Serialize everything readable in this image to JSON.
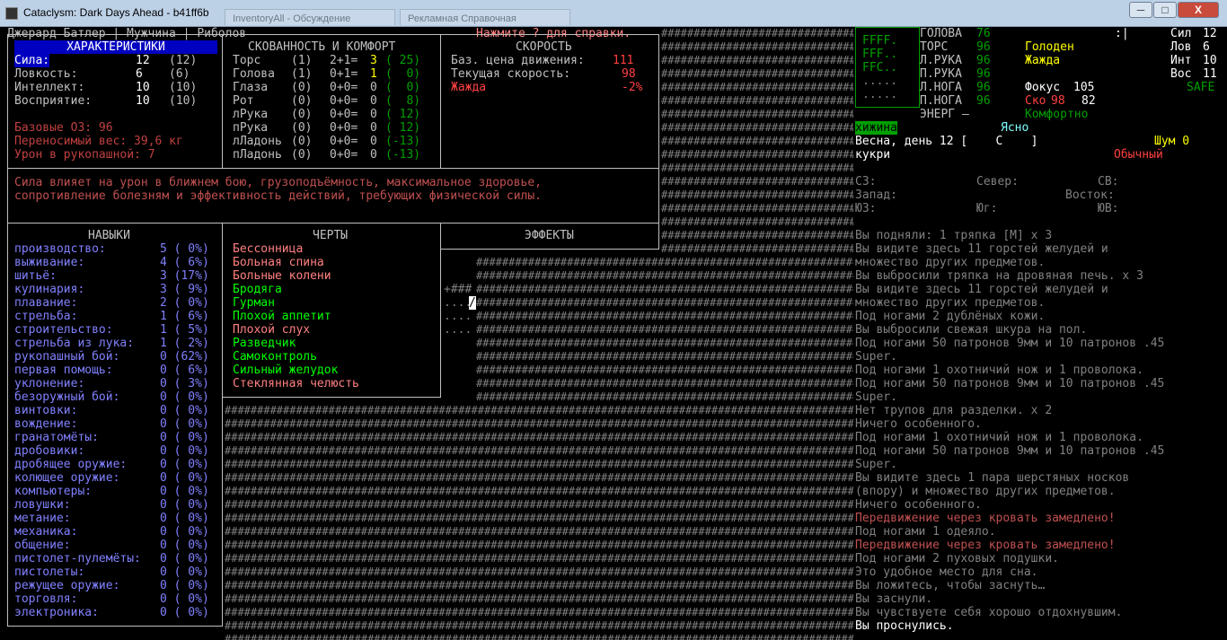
{
  "window": {
    "title": "Cataclysm: Dark Days Ahead - b41ff6b",
    "ghost_tabs": [
      "InventoryAll - Обсуждение",
      "Рекламная Справочная"
    ],
    "buttons": {
      "min": "─",
      "max": "□",
      "close": "X"
    }
  },
  "header": {
    "char_line": "Джерард Батлер | Мужчина | Риболов",
    "help": "Нажмите ? для справки."
  },
  "stats": {
    "title": "ХАРАКТЕРИСТИКИ",
    "rows": [
      {
        "label": "Сила:",
        "val": "12",
        "base": "(12)"
      },
      {
        "label": "Ловкость:",
        "val": "6",
        "base": "(6)"
      },
      {
        "label": "Интеллект:",
        "val": "10",
        "base": "(10)"
      },
      {
        "label": "Восприятие:",
        "val": "10",
        "base": "(10)"
      }
    ],
    "extra": [
      "Базовые ОЗ: 96",
      "Переносимый вес: 39,6 кг",
      "Урон в рукопашной: 7"
    ]
  },
  "encumbrance": {
    "title": "СКОВАННОСТЬ И КОМФОРТ",
    "rows": [
      {
        "part": "Торс",
        "a": "(1)",
        "b": "2+1=",
        "c": "3",
        "d": "( 25)"
      },
      {
        "part": "Голова",
        "a": "(1)",
        "b": "0+1=",
        "c": "1",
        "d": "(  0)"
      },
      {
        "part": "Глаза",
        "a": "(0)",
        "b": "0+0=",
        "c": "0",
        "d": "(  0)"
      },
      {
        "part": "Рот",
        "a": "(0)",
        "b": "0+0=",
        "c": "0",
        "d": "(  8)"
      },
      {
        "part": "лРука",
        "a": "(0)",
        "b": "0+0=",
        "c": "0",
        "d": "( 12)"
      },
      {
        "part": "пРука",
        "a": "(0)",
        "b": "0+0=",
        "c": "0",
        "d": "( 12)"
      },
      {
        "part": "лЛадонь",
        "a": "(0)",
        "b": "0+0=",
        "c": "0",
        "d": "(-13)"
      },
      {
        "part": "пЛадонь",
        "a": "(0)",
        "b": "0+0=",
        "c": "0",
        "d": "(-13)"
      }
    ]
  },
  "speed": {
    "title": "СКОРОСТЬ",
    "rows": [
      {
        "label": "Баз. цена движения:",
        "val": "111"
      },
      {
        "label": "Текущая скорость:",
        "val": "98"
      },
      {
        "label": "Жажда",
        "val": "-2%"
      }
    ]
  },
  "description": "Сила влияет на урон в ближнем бою, грузоподъёмность, максимальное здоровье,\nсопротивление болезням и эффективность действий, требующих физической силы.",
  "skills": {
    "title": "НАВЫКИ",
    "rows": [
      {
        "n": "производство:",
        "v": "5 ( 0%)"
      },
      {
        "n": "выживание:",
        "v": "4 ( 6%)"
      },
      {
        "n": "шитьё:",
        "v": "3 (17%)"
      },
      {
        "n": "кулинария:",
        "v": "3 ( 9%)"
      },
      {
        "n": "плавание:",
        "v": "2 ( 0%)"
      },
      {
        "n": "стрельба:",
        "v": "1 ( 6%)"
      },
      {
        "n": "строительство:",
        "v": "1 ( 5%)"
      },
      {
        "n": "стрельба из лука:",
        "v": "1 ( 2%)"
      },
      {
        "n": "рукопашный бой:",
        "v": "0 (62%)"
      },
      {
        "n": "первая помощь:",
        "v": "0 ( 6%)"
      },
      {
        "n": "уклонение:",
        "v": "0 ( 3%)"
      },
      {
        "n": "безоружный бой:",
        "v": "0 ( 0%)"
      },
      {
        "n": "винтовки:",
        "v": "0 ( 0%)"
      },
      {
        "n": "вождение:",
        "v": "0 ( 0%)"
      },
      {
        "n": "гранатомёты:",
        "v": "0 ( 0%)"
      },
      {
        "n": "дробовики:",
        "v": "0 ( 0%)"
      },
      {
        "n": "дробящее оружие:",
        "v": "0 ( 0%)"
      },
      {
        "n": "колющее оружие:",
        "v": "0 ( 0%)"
      },
      {
        "n": "компьютеры:",
        "v": "0 ( 0%)"
      },
      {
        "n": "ловушки:",
        "v": "0 ( 0%)"
      },
      {
        "n": "метание:",
        "v": "0 ( 0%)"
      },
      {
        "n": "механика:",
        "v": "0 ( 0%)"
      },
      {
        "n": "общение:",
        "v": "0 ( 0%)"
      },
      {
        "n": "пистолет-пулемёты:",
        "v": "0 ( 0%)"
      },
      {
        "n": "пистолеты:",
        "v": "0 ( 0%)"
      },
      {
        "n": "режущее оружие:",
        "v": "0 ( 0%)"
      },
      {
        "n": "торговля:",
        "v": "0 ( 0%)"
      },
      {
        "n": "электроника:",
        "v": "0 ( 0%)"
      }
    ]
  },
  "traits": {
    "title": "ЧЕРТЫ",
    "rows": [
      {
        "t": "Бессонница",
        "bad": true
      },
      {
        "t": "Больная спина",
        "bad": true
      },
      {
        "t": "Больные колени",
        "bad": true
      },
      {
        "t": "Бродяга",
        "bad": false
      },
      {
        "t": "Гурман",
        "bad": false
      },
      {
        "t": "Плохой аппетит",
        "bad": false
      },
      {
        "t": "Плохой слух",
        "bad": true
      },
      {
        "t": "Разведчик",
        "bad": false
      },
      {
        "t": "Самоконтроль",
        "bad": false
      },
      {
        "t": "Сильный желудок",
        "bad": false
      },
      {
        "t": "Стеклянная челюсть",
        "bad": true
      }
    ]
  },
  "effects": {
    "title": "ЭФФЕКТЫ"
  },
  "sidebar": {
    "minimap": [
      "FFFF.",
      "FFF..",
      "FFC..",
      ".....",
      "....."
    ],
    "body": [
      {
        "p": "ГОЛОВА",
        "v": "76"
      },
      {
        "p": "ТОРС",
        "v": "96"
      },
      {
        "p": "Л.РУКА",
        "v": "96"
      },
      {
        "p": "П.РУКА",
        "v": "96"
      },
      {
        "p": "Л.НОГА",
        "v": "96"
      },
      {
        "p": "П.НОГА",
        "v": "96"
      }
    ],
    "energy": "ЭНЕРГ —",
    "status": {
      "hunger": "Голоден",
      "thirst": "Жажда",
      "focus_label": "Фокус",
      "focus": "105",
      "speed_label": "Ско",
      "speed": "98",
      "speed2": "82",
      "comfort": "Комфортно"
    },
    "attrs": [
      {
        "k": "Сил",
        "v": "12"
      },
      {
        "k": "Лов",
        "v": "6"
      },
      {
        "k": "Инт",
        "v": "10"
      },
      {
        "k": "Вос",
        "v": "11"
      }
    ],
    "safe": "SAFE",
    "cursor": ":|",
    "location": "хижина",
    "weather": "Ясно",
    "date": "Весна, день 12 [    С    ]",
    "noise": "Шум 0",
    "wielded": "кукри",
    "mode": "Обычный",
    "compass": {
      "nw": "СЗ:",
      "n": "Север:",
      "ne": "СВ:",
      "w": "Запад:",
      "e": "Восток:",
      "sw": "ЮЗ:",
      "s": "Юг:",
      "se": "ЮВ:"
    }
  },
  "log": [
    "Вы подняли: 1 тряпка [M] x 3",
    "Вы видите здесь 11 горстей желудей и",
    "множество других предметов.",
    "Вы выбросили тряпка на дровяная печь. x 3",
    "Вы видите здесь 11 горстей желудей и",
    "множество других предметов.",
    "Под ногами 2 дублёных кожи.",
    "Вы выбросили свежая шкура на пол.",
    "Под ногами 50 патронов 9мм и 10 патронов .45",
    "Super.",
    "Под ногами 1 охотничий нож и 1 проволока.",
    "Под ногами 50 патронов 9мм и 10 патронов .45",
    "Super.",
    "Нет трупов для разделки. x 2",
    "Ничего особенного.",
    "Под ногами 1 охотничий нож и 1 проволока.",
    "Под ногами 50 патронов 9мм и 10 патронов .45",
    "Super.",
    "Вы видите здесь 1 пара шерстяных носков",
    "(впору) и множество других предметов.",
    "Ничего особенного.",
    "Передвижение через кровать замедлено!",
    "Под ногами 1 одеяло.",
    "Передвижение через кровать замедлено!",
    "Под ногами 2 пуховых подушки.",
    "Это удобное место для сна.",
    "Вы ложитесь, чтобы заснуть…",
    "Вы заснули.",
    "Вы чувствуете себя хорошо отдохнувшим.",
    "Вы проснулись."
  ],
  "log_red": [
    21,
    23
  ],
  "map_glyphs": {
    "wall": "#",
    "floor": ".",
    "player": "/",
    "plus": "+"
  }
}
